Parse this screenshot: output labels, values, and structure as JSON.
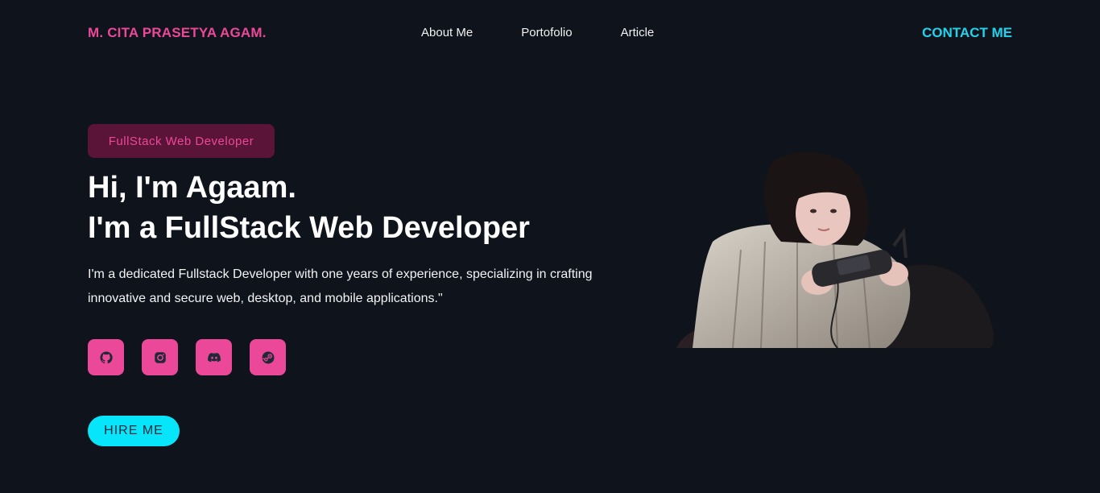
{
  "nav": {
    "brand": "M. CITA PRASETYA AGAM.",
    "links": [
      "About Me",
      "Portofolio",
      "Article"
    ],
    "contact": "CONTACT ME"
  },
  "hero": {
    "badge": "FullStack Web Developer",
    "headline_line1": "Hi, I'm Agaam.",
    "headline_line2": "I'm a FullStack Web Developer",
    "intro_line1": "I'm a dedicated Fullstack Developer with one years of experience, specializing in crafting",
    "intro_line2": "innovative and secure web, desktop, and mobile applications.\"",
    "socials": [
      {
        "icon": "github-icon"
      },
      {
        "icon": "instagram-icon"
      },
      {
        "icon": "discord-icon"
      },
      {
        "icon": "steam-icon"
      }
    ],
    "hire_label": "HIRE  ME"
  },
  "colors": {
    "background": "#0f131b",
    "accent_pink": "#ec4899",
    "accent_cyan": "#22d3ee",
    "badge_bg": "#5a1437"
  }
}
